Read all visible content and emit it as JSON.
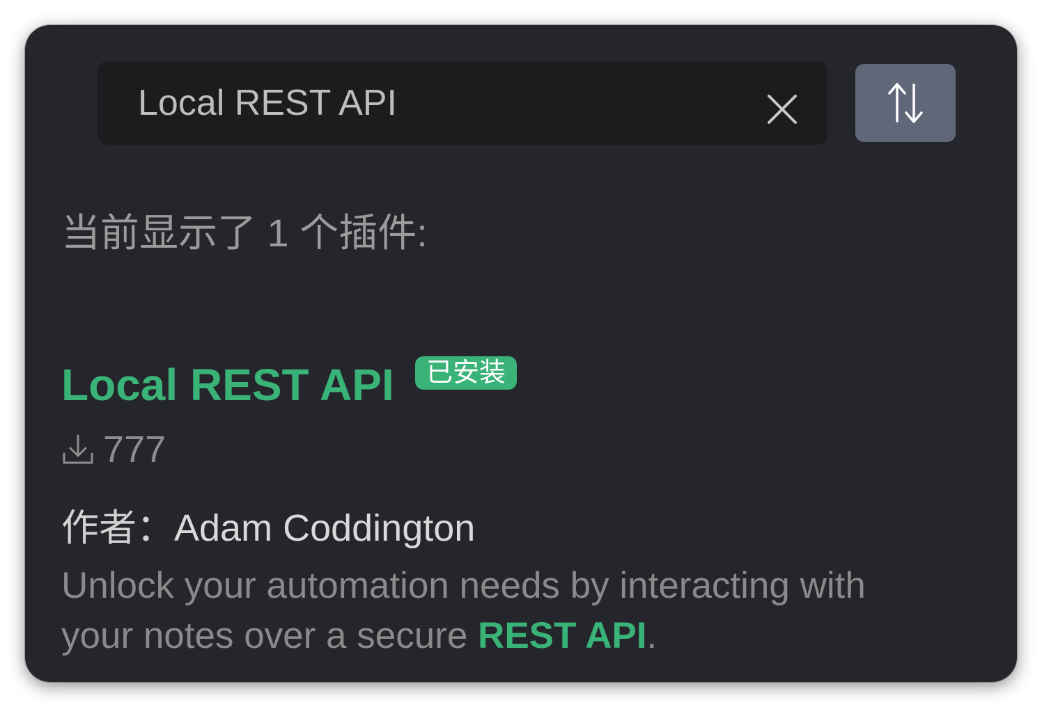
{
  "search": {
    "value": "Local REST API",
    "placeholder": ""
  },
  "icons": {
    "clear": "close-icon",
    "sort": "sort-arrows-icon",
    "downloads": "download-icon"
  },
  "colors": {
    "panel_bg": "#25262b",
    "search_bg": "#1c1c1f",
    "accent_green": "#3ab378",
    "sort_button_bg": "#5f6778"
  },
  "results": {
    "count_text": "当前显示了 1 个插件:"
  },
  "plugin": {
    "name": "Local REST API",
    "badge": "已安装",
    "downloads": "777",
    "author_label": "作者：",
    "author_name": "Adam Coddington",
    "description_prefix": "Unlock your automation needs by interacting with your notes over a secure ",
    "description_highlight": "REST API",
    "description_suffix": "."
  }
}
